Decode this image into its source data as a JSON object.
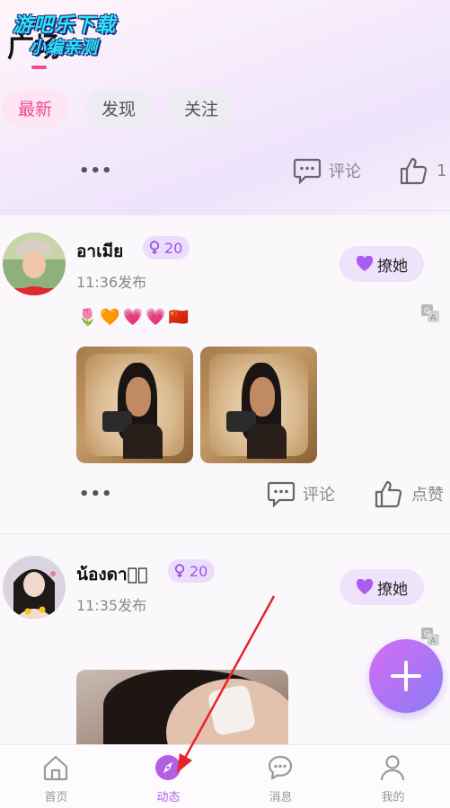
{
  "header": {
    "watermark_line1": "游吧乐下载",
    "watermark_line2": "小编亲测",
    "title": "广场"
  },
  "tabs": [
    {
      "label": "最新",
      "active": true
    },
    {
      "label": "发现",
      "active": false
    },
    {
      "label": "关注",
      "active": false
    }
  ],
  "previous_post_actions": {
    "more": "•••",
    "comment_label": "评论",
    "like_label": "1"
  },
  "posts": [
    {
      "username": "อาเมีย",
      "level": "20",
      "time": "11:36发布",
      "flirt_label": "撩她",
      "emojis": [
        "🌷",
        "🧡",
        "💗",
        "💗",
        "🇨🇳"
      ],
      "more": "•••",
      "comment_label": "评论",
      "like_label": "点赞"
    },
    {
      "username": "น้องดาว⃞",
      "level": "20",
      "time": "11:35发布",
      "flirt_label": "撩她"
    }
  ],
  "bottom_nav": [
    {
      "label": "首页",
      "icon": "home-icon",
      "active": false
    },
    {
      "label": "动态",
      "icon": "compass-icon",
      "active": true
    },
    {
      "label": "消息",
      "icon": "chat-icon",
      "active": false
    },
    {
      "label": "我的",
      "icon": "person-icon",
      "active": false
    }
  ],
  "colors": {
    "accent_pink": "#f04a96",
    "accent_purple": "#b25ee6",
    "annotation_arrow": "#e8232a"
  }
}
